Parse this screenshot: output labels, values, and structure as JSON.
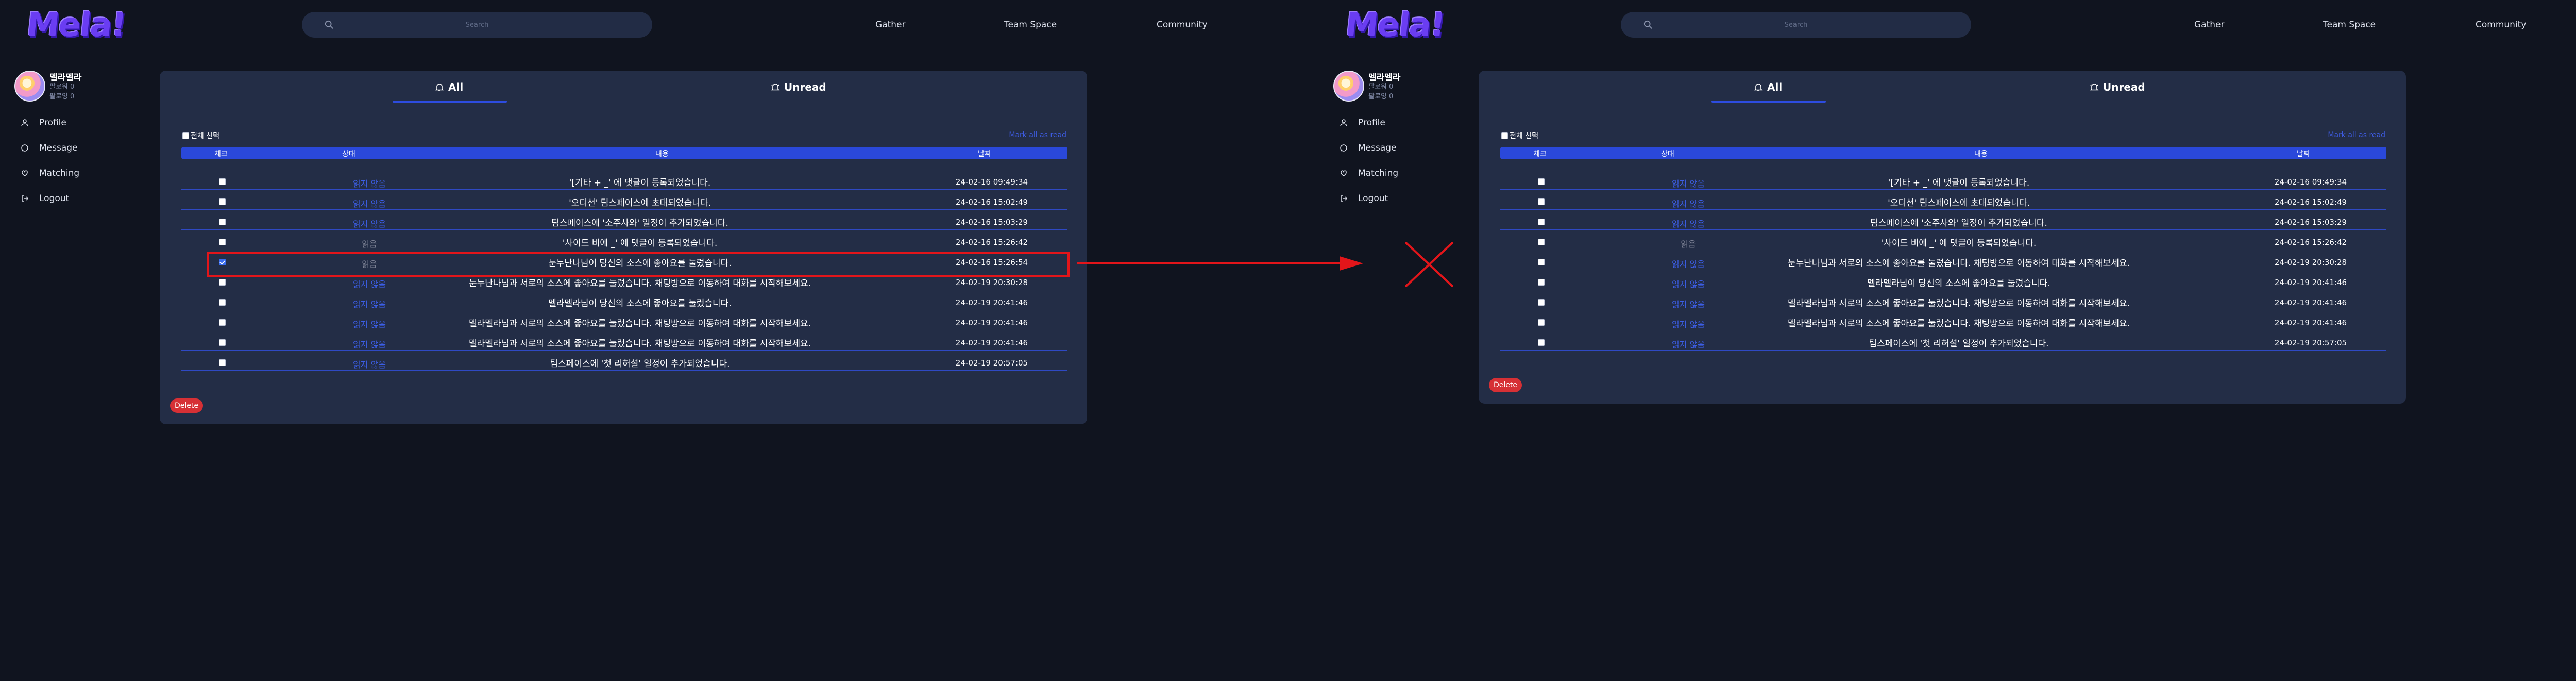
{
  "app": {
    "logo_text": "Mela!",
    "search_placeholder": "Search",
    "nav": {
      "gather": "Gather",
      "team_space": "Team Space",
      "community": "Community"
    }
  },
  "user": {
    "name": "멜라멜라",
    "stat_1": "팔로워 0",
    "stat_2": "팔로잉 0"
  },
  "sidebar": {
    "items": [
      {
        "label": "Profile",
        "icon": "person-icon"
      },
      {
        "label": "Message",
        "icon": "message-icon"
      },
      {
        "label": "Matching",
        "icon": "matching-icon"
      },
      {
        "label": "Logout",
        "icon": "logout-icon"
      }
    ]
  },
  "notifications": {
    "tabs": {
      "all": "All",
      "unread": "Unread"
    },
    "select_all": "전체 선택",
    "mark_all_read": "Mark all as read",
    "columns": [
      "체크",
      "상태",
      "내용",
      "날짜"
    ],
    "delete_label": "Delete",
    "status_unread": "읽지 않음",
    "status_read": "읽음"
  },
  "before": {
    "rows": [
      {
        "checked": false,
        "status": "읽지 않음",
        "status_type": "unread",
        "content": "'[기타 + _' 에 댓글이 등록되었습니다.",
        "date": "24-02-16 09:49:34"
      },
      {
        "checked": false,
        "status": "읽지 않음",
        "status_type": "unread",
        "content": "'오디션' 팀스페이스에 초대되었습니다.",
        "date": "24-02-16 15:02:49"
      },
      {
        "checked": false,
        "status": "읽지 않음",
        "status_type": "unread",
        "content": "팀스페이스에 '소주사와' 일정이 추가되었습니다.",
        "date": "24-02-16 15:03:29"
      },
      {
        "checked": false,
        "status": "읽음",
        "status_type": "read",
        "content": "'사이드 비에 _' 에 댓글이 등록되었습니다.",
        "date": "24-02-16 15:26:42"
      },
      {
        "checked": true,
        "status": "읽음",
        "status_type": "read",
        "content": "눈누난나님이 당신의 소스에 좋아요를 눌렀습니다.",
        "date": "24-02-16 15:26:54"
      },
      {
        "checked": false,
        "status": "읽지 않음",
        "status_type": "unread",
        "content": "눈누난나님과 서로의 소스에 좋아요를 눌렀습니다. 채팅방으로 이동하여 대화를 시작해보세요.",
        "date": "24-02-19 20:30:28"
      },
      {
        "checked": false,
        "status": "읽지 않음",
        "status_type": "unread",
        "content": "멜라멜라님이 당신의 소스에 좋아요를 눌렀습니다.",
        "date": "24-02-19 20:41:46"
      },
      {
        "checked": false,
        "status": "읽지 않음",
        "status_type": "unread",
        "content": "멜라멜라님과 서로의 소스에 좋아요를 눌렀습니다. 채팅방으로 이동하여 대화를 시작해보세요.",
        "date": "24-02-19 20:41:46"
      },
      {
        "checked": false,
        "status": "읽지 않음",
        "status_type": "unread",
        "content": "멜라멜라님과 서로의 소스에 좋아요를 눌렀습니다. 채팅방으로 이동하여 대화를 시작해보세요.",
        "date": "24-02-19 20:41:46"
      },
      {
        "checked": false,
        "status": "읽지 않음",
        "status_type": "unread",
        "content": "팀스페이스에 '첫 리허설' 일정이 추가되었습니다.",
        "date": "24-02-19 20:57:05"
      }
    ]
  },
  "after": {
    "rows": [
      {
        "checked": false,
        "status": "읽지 않음",
        "status_type": "unread",
        "content": "'[기타 + _' 에 댓글이 등록되었습니다.",
        "date": "24-02-16 09:49:34"
      },
      {
        "checked": false,
        "status": "읽지 않음",
        "status_type": "unread",
        "content": "'오디션' 팀스페이스에 초대되었습니다.",
        "date": "24-02-16 15:02:49"
      },
      {
        "checked": false,
        "status": "읽지 않음",
        "status_type": "unread",
        "content": "팀스페이스에 '소주사와' 일정이 추가되었습니다.",
        "date": "24-02-16 15:03:29"
      },
      {
        "checked": false,
        "status": "읽음",
        "status_type": "read",
        "content": "'사이드 비에 _' 에 댓글이 등록되었습니다.",
        "date": "24-02-16 15:26:42"
      },
      {
        "checked": false,
        "status": "읽지 않음",
        "status_type": "unread",
        "content": "눈누난나님과 서로의 소스에 좋아요를 눌렀습니다. 채팅방으로 이동하여 대화를 시작해보세요.",
        "date": "24-02-19 20:30:28"
      },
      {
        "checked": false,
        "status": "읽지 않음",
        "status_type": "unread",
        "content": "멜라멜라님이 당신의 소스에 좋아요를 눌렀습니다.",
        "date": "24-02-19 20:41:46"
      },
      {
        "checked": false,
        "status": "읽지 않음",
        "status_type": "unread",
        "content": "멜라멜라님과 서로의 소스에 좋아요를 눌렀습니다. 채팅방으로 이동하여 대화를 시작해보세요.",
        "date": "24-02-19 20:41:46"
      },
      {
        "checked": false,
        "status": "읽지 않음",
        "status_type": "unread",
        "content": "멜라멜라님과 서로의 소스에 좋아요를 눌렀습니다. 채팅방으로 이동하여 대화를 시작해보세요.",
        "date": "24-02-19 20:41:46"
      },
      {
        "checked": false,
        "status": "읽지 않음",
        "status_type": "unread",
        "content": "팀스페이스에 '첫 리허설' 일정이 추가되었습니다.",
        "date": "24-02-19 20:57:05"
      }
    ]
  },
  "annotation": {
    "highlight_color": "#e3151a",
    "arrow_icon": "arrow-right-icon",
    "cross_icon": "cross-icon"
  }
}
